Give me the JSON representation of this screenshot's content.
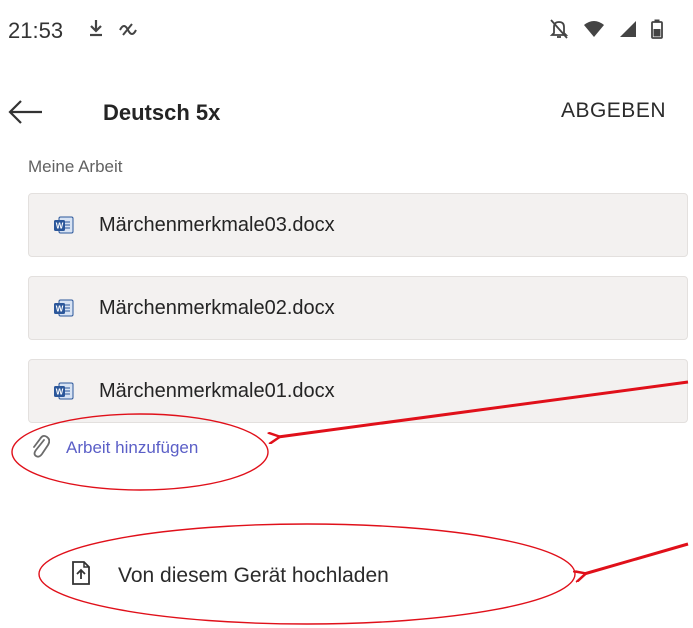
{
  "status_bar": {
    "time": "21:53",
    "left_icons": [
      "download-icon",
      "signal-assist-icon"
    ],
    "right_icons": [
      "notifications-off-icon",
      "wifi-icon",
      "cell-signal-icon",
      "battery-icon"
    ]
  },
  "header": {
    "back_icon": "arrow-left-icon",
    "title": "Deutsch 5x",
    "submit_label": "ABGEBEN"
  },
  "section_label": "Meine Arbeit",
  "files": [
    {
      "name": "Märchenmerkmale03.docx",
      "icon": "word-doc-icon"
    },
    {
      "name": "Märchenmerkmale02.docx",
      "icon": "word-doc-icon"
    },
    {
      "name": "Märchenmerkmale01.docx",
      "icon": "word-doc-icon"
    }
  ],
  "add_work": {
    "label": "Arbeit hinzufügen",
    "icon": "paperclip-icon"
  },
  "upload": {
    "label": "Von diesem Gerät hochladen",
    "icon": "upload-file-icon"
  },
  "colors": {
    "accent": "#5b5fc7",
    "annotation": "#e0101a",
    "card_bg": "#f3f1f0",
    "word_blue": "#2b579a"
  }
}
